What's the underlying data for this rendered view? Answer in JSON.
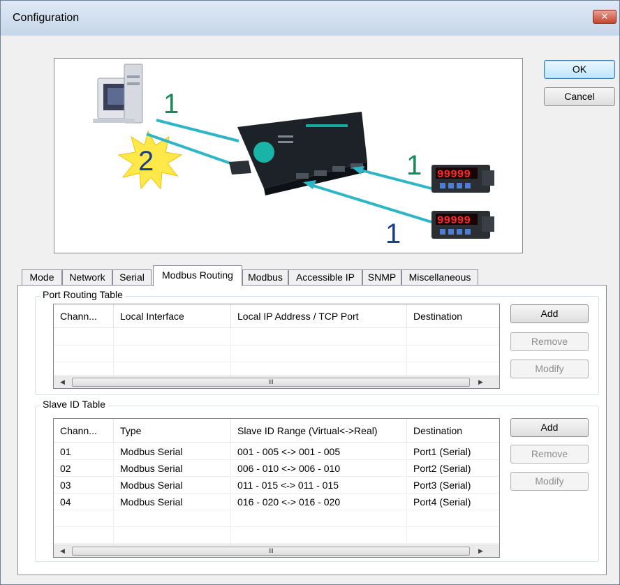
{
  "window": {
    "title": "Configuration",
    "close_glyph": "✕"
  },
  "dialog_buttons": {
    "ok": "OK",
    "cancel": "Cancel"
  },
  "illustration": {
    "labels": {
      "top_left": "1",
      "burst": "2",
      "right": "1",
      "bottom": "1"
    },
    "meter_readout": "99999",
    "colors": {
      "link": "#2fb6c6",
      "green_label": "#1a8a5a",
      "blue_label": "#1c3f8c",
      "burst": "#ffe84a"
    }
  },
  "tabs": [
    {
      "label": "Mode"
    },
    {
      "label": "Network"
    },
    {
      "label": "Serial"
    },
    {
      "label": "Modbus Routing",
      "active": true
    },
    {
      "label": "Modbus"
    },
    {
      "label": "Accessible IP"
    },
    {
      "label": "SNMP"
    },
    {
      "label": "Miscellaneous"
    }
  ],
  "port_routing": {
    "group_label": "Port Routing Table",
    "columns": [
      "Chann...",
      "Local Interface",
      "Local IP Address / TCP Port",
      "Destination"
    ],
    "rows": [],
    "buttons": {
      "add": "Add",
      "remove": "Remove",
      "modify": "Modify"
    },
    "scroll_thumb_glyph": "III"
  },
  "slave_id": {
    "group_label": "Slave ID Table",
    "columns": [
      "Chann...",
      "Type",
      "Slave ID Range (Virtual<->Real)",
      "Destination"
    ],
    "rows": [
      [
        "01",
        "Modbus Serial",
        "001 - 005 <-> 001 - 005",
        "Port1 (Serial)"
      ],
      [
        "02",
        "Modbus Serial",
        "006 - 010 <-> 006 - 010",
        "Port2 (Serial)"
      ],
      [
        "03",
        "Modbus Serial",
        "011 - 015 <-> 011 - 015",
        "Port3 (Serial)"
      ],
      [
        "04",
        "Modbus Serial",
        "016 - 020 <-> 016 - 020",
        "Port4 (Serial)"
      ]
    ],
    "buttons": {
      "add": "Add",
      "remove": "Remove",
      "modify": "Modify"
    },
    "scroll_thumb_glyph": "III"
  },
  "scroll_arrows": {
    "left": "◀",
    "right": "▶"
  }
}
